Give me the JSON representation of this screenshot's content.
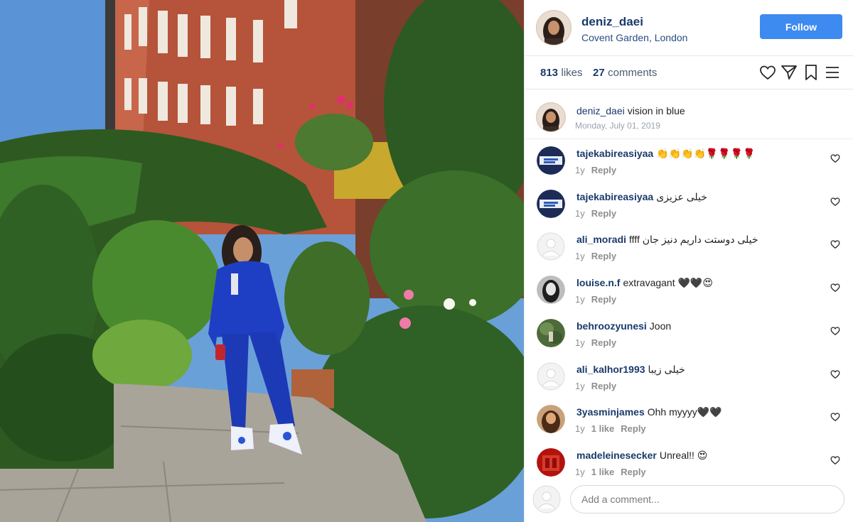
{
  "post": {
    "username": "deniz_daei",
    "location": "Covent Garden, London",
    "follow_label": "Follow",
    "likes_count": "813",
    "likes_label": "likes",
    "comments_count": "27",
    "comments_label": "comments",
    "caption_user": "deniz_daei",
    "caption_text": "vision in blue",
    "date": "Monday, July 01, 2019"
  },
  "comments": [
    {
      "user": "tajekabireasiyaa",
      "text": "👏👏👏👏🌹🌹🌹🌹",
      "age": "1y",
      "likes": "",
      "reply": "Reply",
      "avatar": "flag"
    },
    {
      "user": "tajekabireasiyaa",
      "text": "خیلی عزیزی",
      "age": "1y",
      "likes": "",
      "reply": "Reply",
      "avatar": "flag"
    },
    {
      "user": "ali_moradi",
      "text": "ffff خیلی دوستت داریم دنیز جان",
      "age": "1y",
      "likes": "",
      "reply": "Reply",
      "avatar": "default"
    },
    {
      "user": "louise.n.f",
      "text": "extravagant 🖤🖤😍",
      "age": "1y",
      "likes": "",
      "reply": "Reply",
      "avatar": "portrait-dark"
    },
    {
      "user": "behroozyunesi",
      "text": "Joon",
      "age": "1y",
      "likes": "",
      "reply": "Reply",
      "avatar": "greenery"
    },
    {
      "user": "ali_kalhor1993",
      "text": "خیلی زیبا",
      "age": "1y",
      "likes": "",
      "reply": "Reply",
      "avatar": "default"
    },
    {
      "user": "3yasminjames",
      "text": "Ohh myyyy🖤🖤",
      "age": "1y",
      "likes": "1 like",
      "reply": "Reply",
      "avatar": "portrait-warm"
    },
    {
      "user": "madeleinesecker",
      "text": "Unreal!! 😍",
      "age": "1y",
      "likes": "1 like",
      "reply": "Reply",
      "avatar": "red"
    }
  ],
  "add_comment": {
    "placeholder": "Add a comment..."
  },
  "icons": [
    "heart-icon",
    "paper-plane-icon",
    "bookmark-icon",
    "menu-icon"
  ],
  "colors": {
    "follow": "#3d8af0",
    "username": "#1a3a6b",
    "suit_blue": "#1e3fc4"
  }
}
